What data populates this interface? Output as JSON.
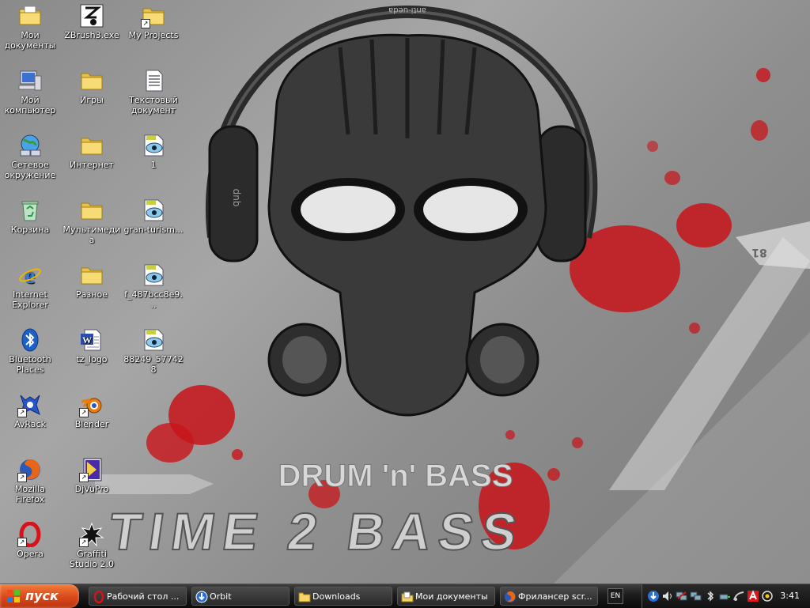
{
  "desktop": {
    "icons": [
      {
        "label": "Мои документы",
        "icon": "my-documents-icon"
      },
      {
        "label": "ZBrush3.exe",
        "icon": "zbrush-icon"
      },
      {
        "label": "My Projects",
        "icon": "folder-icon"
      },
      {
        "label": "Мой компьютер",
        "icon": "my-computer-icon"
      },
      {
        "label": "Игры",
        "icon": "folder-icon"
      },
      {
        "label": "Текстовый документ",
        "icon": "text-document-icon"
      },
      {
        "label": "Сетевое окружение",
        "icon": "network-icon"
      },
      {
        "label": "Интернет",
        "icon": "folder-icon"
      },
      {
        "label": "1",
        "icon": "image-file-icon"
      },
      {
        "label": "Корзина",
        "icon": "recycle-bin-icon"
      },
      {
        "label": "Мультимедиа",
        "icon": "folder-icon"
      },
      {
        "label": "gran-turism...",
        "icon": "image-file-icon"
      },
      {
        "label": "Internet Explorer",
        "icon": "internet-explorer-icon"
      },
      {
        "label": "Разное",
        "icon": "folder-icon"
      },
      {
        "label": "f_487bcc8e9...",
        "icon": "image-file-icon"
      },
      {
        "label": "Bluetooth Places",
        "icon": "bluetooth-icon"
      },
      {
        "label": "tz_logo",
        "icon": "word-document-icon"
      },
      {
        "label": "88249_577428",
        "icon": "image-file-icon"
      },
      {
        "label": "AvRack",
        "icon": "avrack-icon"
      },
      {
        "label": "Blender",
        "icon": "blender-icon"
      },
      {
        "label": "Mozilla Firefox",
        "icon": "firefox-icon"
      },
      {
        "label": "DjVuPro",
        "icon": "djvu-icon"
      },
      {
        "label": "Opera",
        "icon": "opera-icon"
      },
      {
        "label": "Graffiti Studio 2.0",
        "icon": "graffiti-studio-icon"
      }
    ]
  },
  "wallpaper": {
    "headline": "DRUM 'n' BASS",
    "subline": "TIME 2 BASS",
    "headphone_band_text": "anti-ueda",
    "cup_text": "dnb",
    "corner_number": "81"
  },
  "taskbar": {
    "start_label": "пуск",
    "tasks": [
      {
        "label": "Рабочий стол ...",
        "icon": "opera-icon"
      },
      {
        "label": "Orbit",
        "icon": "download-icon"
      },
      {
        "label": "Downloads",
        "icon": "folder-icon"
      },
      {
        "label": "Мои документы",
        "icon": "my-documents-icon"
      },
      {
        "label": "Фрилансер scr...",
        "icon": "firefox-icon"
      }
    ],
    "language": "EN",
    "clock": "3:41"
  },
  "colors": {
    "start": "#d9481a",
    "taskbar": "#1c1c1c",
    "blood": "#c8141a",
    "folder": "#f5d565"
  }
}
